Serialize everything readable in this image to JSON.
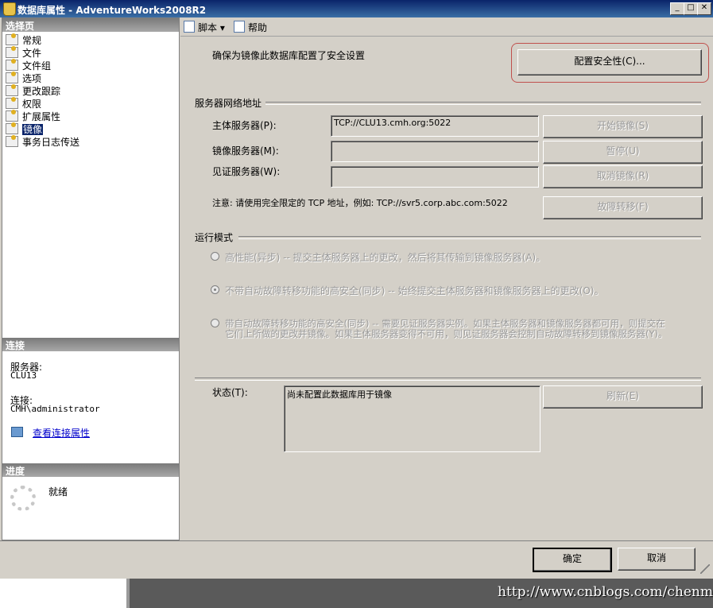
{
  "window": {
    "title": "数据库属性 - AdventureWorks2008R2"
  },
  "left": {
    "select_page_header": "选择页",
    "nav_items": [
      "常规",
      "文件",
      "文件组",
      "选项",
      "更改跟踪",
      "权限",
      "扩展属性",
      "镜像",
      "事务日志传送"
    ],
    "connection_header": "连接",
    "server_label": "服务器:",
    "server_value": "CLU13",
    "connection_label": "连接:",
    "connection_value": "CMH\\administrator",
    "view_conn_props": "查看连接属性",
    "progress_header": "进度",
    "progress_status": "就绪"
  },
  "toolbar": {
    "script": "脚本",
    "help": "帮助"
  },
  "main": {
    "security_note": "确保为镜像此数据库配置了安全设置",
    "configure_security_button": "配置安全性(C)...",
    "network_group_title": "服务器网络地址",
    "principal_label": "主体服务器(P):",
    "principal_value": "TCP://CLU13.cmh.org:5022",
    "mirror_label": "镜像服务器(M):",
    "mirror_value": "",
    "witness_label": "见证服务器(W):",
    "witness_value": "",
    "start_mirror_button": "开始镜像(S)",
    "pause_button": "暂停(U)",
    "remove_mirror_button": "取消镜像(R)",
    "failover_button": "故障转移(F)",
    "note_text": "注意: 请使用完全限定的 TCP 地址，例如: TCP://svr5.corp.abc.com:5022",
    "mode_group_title": "运行模式",
    "mode_high_performance": "高性能(异步) -- 提交主体服务器上的更改，然后将其传输到镜像服务器(A)。",
    "mode_high_safety_no_failover": "不带自动故障转移功能的高安全(同步) -- 始终提交主体服务器和镜像服务器上的更改(O)。",
    "mode_high_safety_failover_line1": "带自动故障转移功能的高安全(同步) -- 需要见证服务器实例。如果主体服务器和镜像服务器都可用，则提交在",
    "mode_high_safety_failover_line2": "它们上所做的更改并镜像。如果主体服务器变得不可用，则见证服务器会控制自动故障转移到镜像服务器(Y)。",
    "status_label": "状态(T):",
    "status_value": "尚未配置此数据库用于镜像",
    "refresh_button": "刷新(E)"
  },
  "footer": {
    "ok_button": "确定",
    "cancel_button": "取消"
  },
  "watermark": "http://www.cnblogs.com/chenmh/",
  "colors": {
    "titlebar": "#0a246a",
    "selection": "#0a246a",
    "highlight_ring": "#c0504d"
  }
}
